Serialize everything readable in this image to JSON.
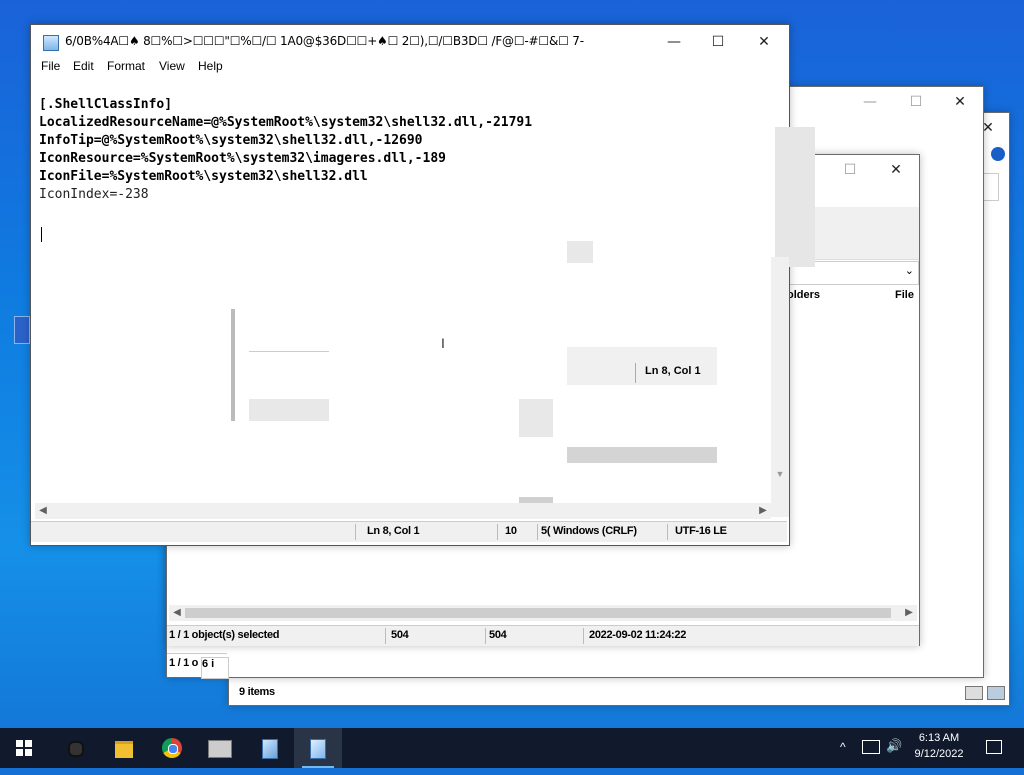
{
  "notepad": {
    "title": "6/0B%4A☐♠ 8☐%☐>☐☐☐\"☐%☐/☐ 1A0@$36D☐☐+♠☐ 2☐),☐/☐B3D☐  /F@☐-#☐&☐ 7-",
    "menu": [
      "File",
      "Edit",
      "Format",
      "View",
      "Help"
    ],
    "lines": [
      "[.ShellClassInfo]",
      "LocalizedResourceName=@%SystemRoot%\\system32\\shell32.dll,-21791",
      "InfoTip=@%SystemRoot%\\system32\\shell32.dll,-12690",
      "IconResource=%SystemRoot%\\system32\\imageres.dll,-189",
      "IconFile=%SystemRoot%\\system32\\shell32.dll",
      "IconIndex=-238"
    ],
    "status": {
      "position": "Ln 8, Col 1",
      "zoom": "10",
      "line_ending": "Windows (CRLF)",
      "encoding": "UTF-16 LE",
      "ghost_position": "Ln 8, Col 1",
      "ghost_zoom": "5("
    }
  },
  "explorer": {
    "column_folders": "olders",
    "column_file": "File",
    "status_selected": "1 / 1 object(s) selected",
    "status_size1": "504",
    "status_size2": "504",
    "status_date": "2022-09-02 11:24:22",
    "status_behind": "1 / 1 o",
    "status_behind2": "6 i",
    "items_count": "9 items"
  },
  "taskbar": {
    "time": "6:13 AM",
    "date": "9/12/2022"
  },
  "icons": {
    "start": "windows-start-icon",
    "chrome": "chrome-icon",
    "explorer": "file-explorer-icon",
    "notepad": "notepad-icon"
  }
}
